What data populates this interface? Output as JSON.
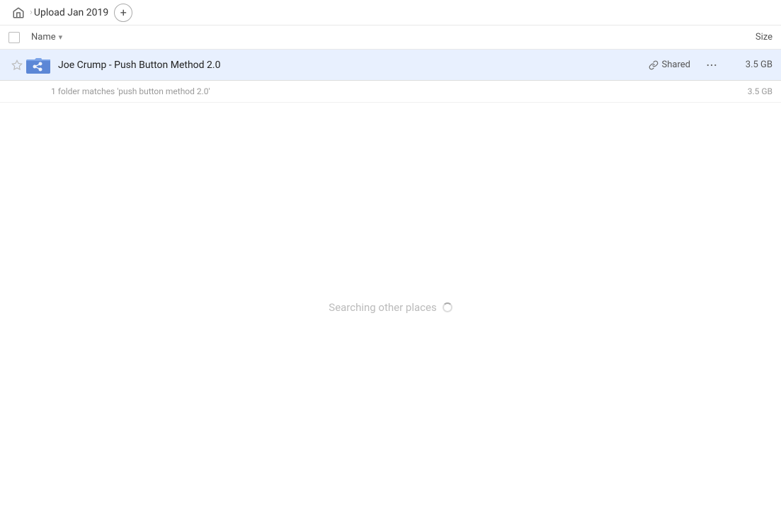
{
  "header": {
    "breadcrumb_title": "Upload Jan 2019",
    "home_icon": "home",
    "add_button_label": "+"
  },
  "columns": {
    "name_label": "Name",
    "size_label": "Size"
  },
  "file_row": {
    "name": "Joe Crump - Push Button Method 2.0",
    "shared_label": "Shared",
    "size": "3.5 GB"
  },
  "match_info": {
    "text": "1 folder matches 'push button method 2.0'",
    "size": "3.5 GB"
  },
  "searching": {
    "text": "Searching other places"
  }
}
